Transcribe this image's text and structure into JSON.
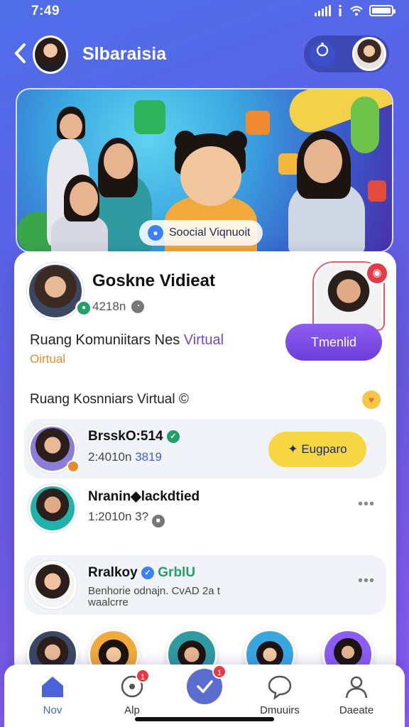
{
  "status_bar": {
    "time": "7:49"
  },
  "header": {
    "title": "Slbaraisia"
  },
  "banner": {
    "tag_label": "Soocial Viqnuoit"
  },
  "profile": {
    "name": "Goskne Vidieat",
    "meta": "4218n",
    "community_line1_prefix": "Ruang Komuniitars Nes ",
    "community_line1_accent": "Virtual",
    "community_line2": "Oirtual",
    "join_label": "Tmenlid"
  },
  "section": {
    "title": "Ruang Kosnniars Virtual ©"
  },
  "rows": [
    {
      "name": "BrsskO:514",
      "sub_prefix": "2:4010n ",
      "sub_num": "3819",
      "action_label": "Eugparo"
    },
    {
      "name": "Nranin◆lackdtied",
      "sub_prefix": "1:2010n 3?",
      "sub_num": ""
    },
    {
      "name_prefix": "Rralkoy ",
      "name_green": "GrblU",
      "sub_line1": "Benhorie odnajn. CvAD 2a t",
      "sub_line2": "waalcrre"
    }
  ],
  "nav": [
    {
      "label": "Nov"
    },
    {
      "label": "Alp",
      "badge": "1"
    },
    {
      "label": "",
      "badge": "1"
    },
    {
      "label": "Dmuuirs"
    },
    {
      "label": "Daeate"
    }
  ],
  "colors": {
    "background_start": "#4f6ee8",
    "background_end": "#8b5cf6",
    "primary": "#6b3fd8",
    "accent_yellow": "#f6d743",
    "badge_red": "#e53946"
  }
}
